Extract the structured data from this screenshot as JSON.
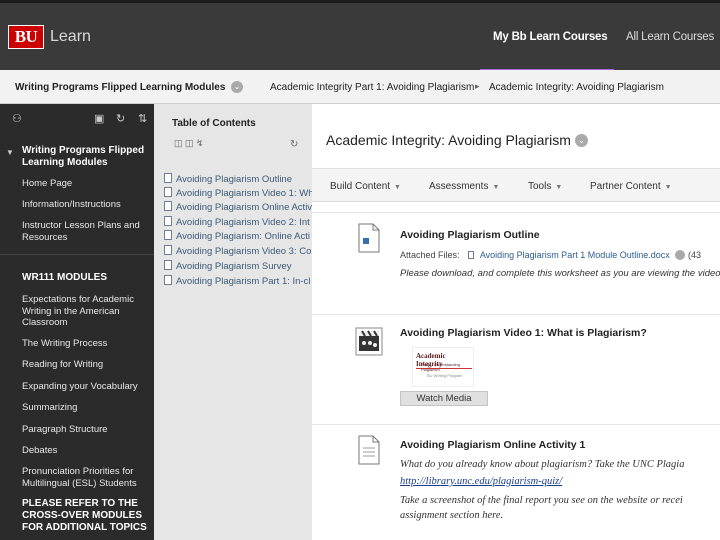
{
  "header": {
    "logo_text": "BU",
    "app_label": "Learn",
    "tabs": [
      {
        "label": "My Bb Learn Courses",
        "active": true
      },
      {
        "label": "All Learn Courses",
        "active": false
      }
    ],
    "accent": "#a06bd0",
    "brand_red": "#cc0000"
  },
  "breadcrumb": {
    "items": [
      "Writing Programs Flipped Learning Modules",
      "Academic Integrity Part 1: Avoiding Plagiarism",
      "Academic Integrity: Avoiding Plagiarism"
    ]
  },
  "sidebar": {
    "course_title": "Writing Programs Flipped Learning Modules",
    "items": [
      "Home Page",
      "Information/Instructions",
      "Instructor Lesson Plans and Resources"
    ],
    "section_heading": "WR111 MODULES",
    "modules": [
      "Expectations for Academic Writing in the American Classroom",
      "The Writing Process",
      "Reading for Writing",
      "Expanding your Vocabulary",
      "Summarizing",
      "Paragraph Structure",
      "Debates",
      "Pronunciation Priorities for Multilingual (ESL) Students"
    ],
    "footer_notice": "PLEASE REFER TO THE CROSS-OVER MODULES FOR ADDITIONAL TOPICS"
  },
  "toc": {
    "title": "Table of Contents",
    "items": [
      "Avoiding Plagiarism Outline",
      "Avoiding Plagiarism Video 1: Wh",
      "Avoiding Plagiarism Online Activ",
      "Avoiding Plagiarism Video 2: Int",
      "Avoiding Plagiarism: Online Acti",
      "Avoiding Plagiarism Video 3: Co",
      "Avoiding Plagiarism Survey",
      "Avoiding Plagiarism Part 1: In-cl"
    ]
  },
  "main": {
    "title": "Academic Integrity: Avoiding Plagiarism",
    "actions": [
      "Build Content",
      "Assessments",
      "Tools",
      "Partner Content"
    ],
    "items": [
      {
        "title": "Avoiding Plagiarism Outline",
        "attached_label": "Attached Files:",
        "attached_file": "Avoiding Plagiarism Part 1 Module Outline.docx",
        "attached_size": "(43",
        "description": "Please download, and complete this worksheet as you are viewing the video"
      },
      {
        "title": "Avoiding Plagiarism Video 1: What is Plagiarism?",
        "thumb_title": "Academic Integrity",
        "thumb_sub": "Part 1: Understanding Plagiarism",
        "thumb_foot": "BU Writing Program",
        "button_label": "Watch Media"
      },
      {
        "title": "Avoiding Plagiarism Online Activity 1",
        "line1": "What do you already know about plagiarism? Take the UNC Plagia",
        "link": "http://library.unc.edu/plagiarism-quiz/",
        "line3": "Take a screenshot of the final report you see on the website or recei",
        "line4": "assignment section here."
      }
    ]
  }
}
